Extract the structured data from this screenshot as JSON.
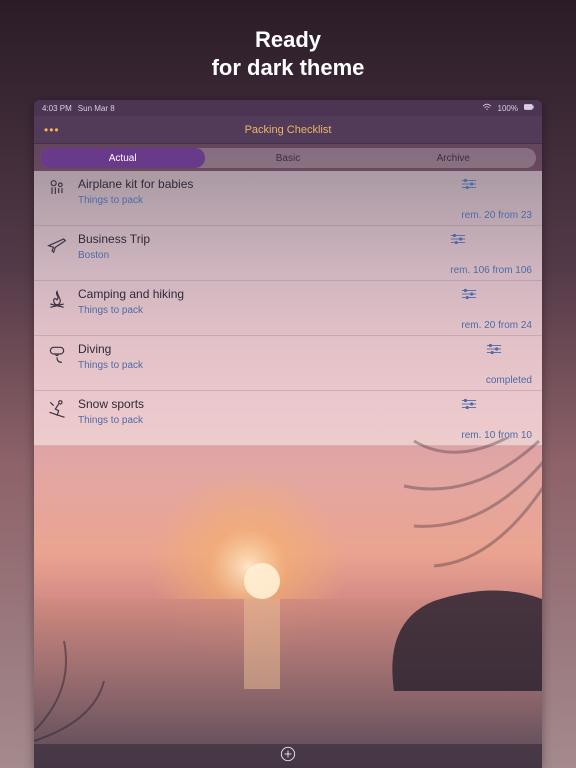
{
  "promo": {
    "line1": "Ready",
    "line2": "for dark theme"
  },
  "status": {
    "time": "4:03 PM",
    "date": "Sun Mar 8",
    "battery": "100%"
  },
  "nav": {
    "title": "Packing Checklist",
    "more": "•••"
  },
  "tabs": [
    {
      "label": "Actual",
      "selected": true
    },
    {
      "label": "Basic",
      "selected": false
    },
    {
      "label": "Archive",
      "selected": false
    }
  ],
  "lists": [
    {
      "icon": "baby",
      "title": "Airplane kit for babies",
      "subtitle": "Things to pack",
      "status": "rem. 20 from 23"
    },
    {
      "icon": "plane",
      "title": "Business Trip",
      "subtitle": "Boston",
      "status": "rem. 106 from 106"
    },
    {
      "icon": "camp",
      "title": "Camping and hiking",
      "subtitle": "Things to pack",
      "status": "rem. 20 from 24"
    },
    {
      "icon": "dive",
      "title": "Diving",
      "subtitle": "Things to pack",
      "status": "completed"
    },
    {
      "icon": "ski",
      "title": "Snow sports",
      "subtitle": "Things to pack",
      "status": "rem. 10 from 10"
    }
  ]
}
